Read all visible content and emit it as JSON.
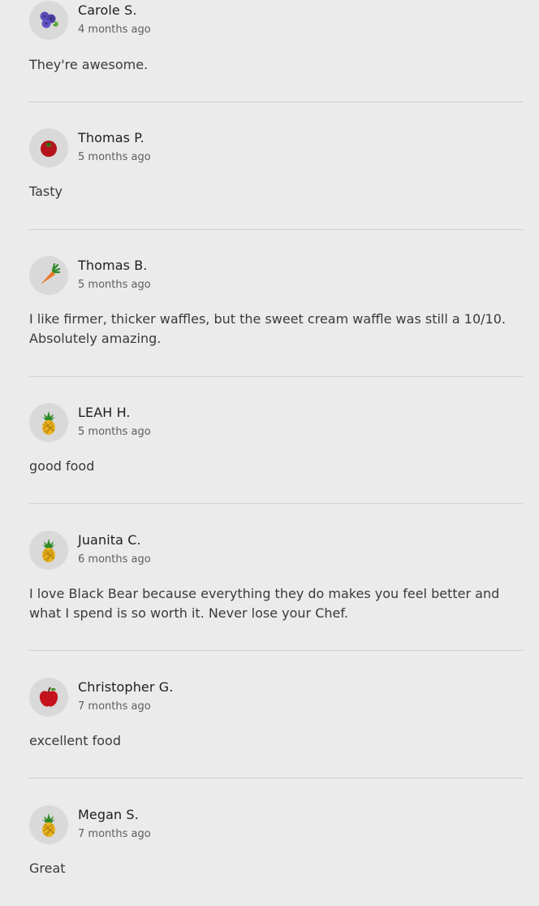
{
  "reviews": [
    {
      "name": "Carole S.",
      "time": "4 months ago",
      "text": "They're awesome.",
      "avatar": "blueberries-icon"
    },
    {
      "name": "Thomas P.",
      "time": "5 months ago",
      "text": "Tasty",
      "avatar": "tomato-icon"
    },
    {
      "name": "Thomas B.",
      "time": "5 months ago",
      "text": "I like firmer, thicker waffles, but the sweet cream waffle was still a 10/10. Absolutely amazing.",
      "avatar": "carrot-icon"
    },
    {
      "name": "LEAH H.",
      "time": "5 months ago",
      "text": "good food",
      "avatar": "pineapple-icon"
    },
    {
      "name": "Juanita C.",
      "time": "6 months ago",
      "text": "I love Black Bear because everything they do makes you feel better and what I spend is so worth it. Never lose your Chef.",
      "avatar": "pineapple-icon"
    },
    {
      "name": "Christopher G.",
      "time": "7 months ago",
      "text": "excellent food",
      "avatar": "apple-icon"
    },
    {
      "name": "Megan S.",
      "time": "7 months ago",
      "text": "Great",
      "avatar": "pineapple-icon"
    }
  ]
}
